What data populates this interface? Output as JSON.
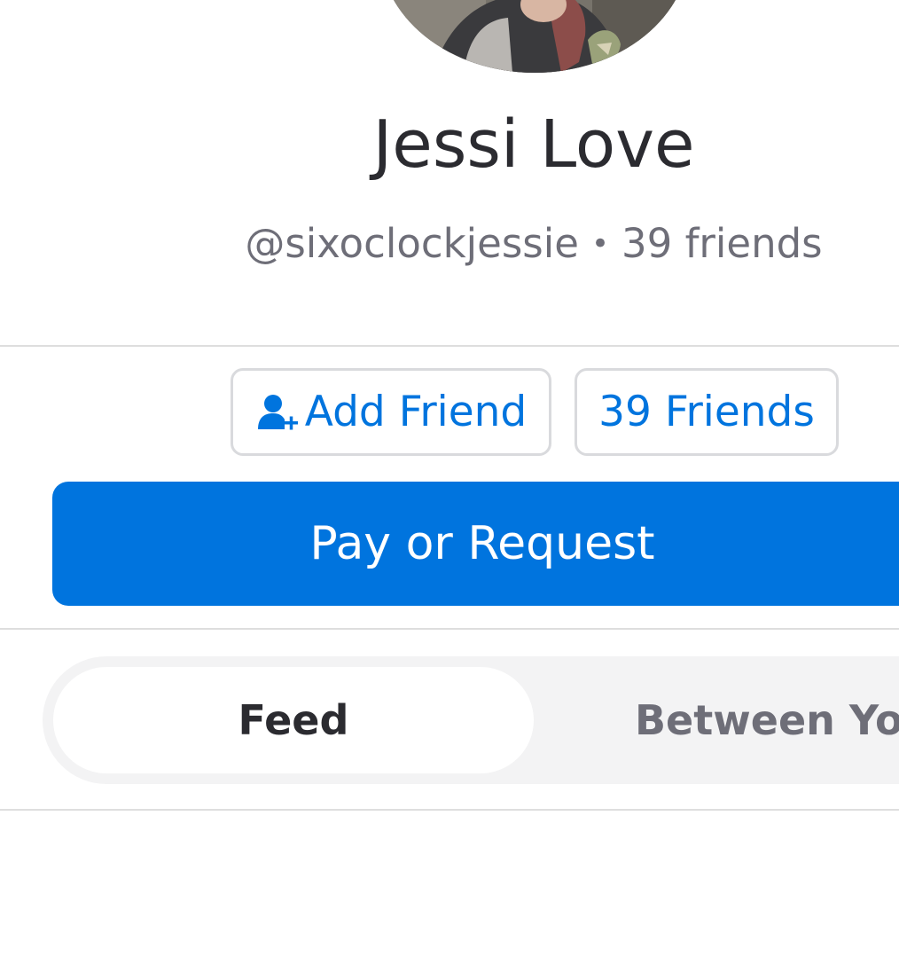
{
  "profile": {
    "display_name": "Jessi Love",
    "username": "@sixoclockjessie",
    "separator": "•",
    "friend_count_text": "39 friends"
  },
  "actions": {
    "add_friend_label": "Add Friend",
    "add_friend_icon": "add-person-icon",
    "friends_label": "39 Friends",
    "pay_request_label": "Pay or Request"
  },
  "tabs": [
    {
      "label": "Feed",
      "selected": true
    },
    {
      "label": "Between You",
      "selected": false
    }
  ],
  "colors": {
    "accent": "#0074de",
    "text_primary": "#2b2b30",
    "text_secondary": "#6e6e78",
    "segment_bg": "#f3f3f4"
  }
}
